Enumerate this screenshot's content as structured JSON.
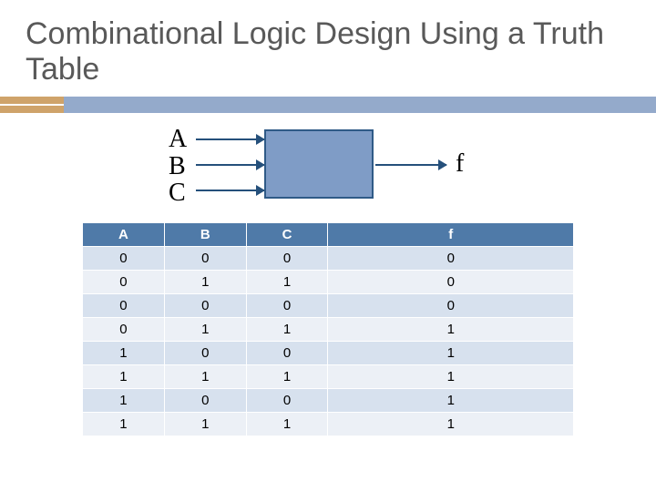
{
  "title": "Combinational Logic Design Using a Truth Table",
  "diagram": {
    "inputs": [
      "A",
      "B",
      "C"
    ],
    "output": "f"
  },
  "table": {
    "headers": {
      "a": "A",
      "b": "B",
      "c": "C",
      "f": "f"
    },
    "rows": [
      {
        "a": "0",
        "b": "0",
        "c": "0",
        "f": "0"
      },
      {
        "a": "0",
        "b": "1",
        "c": "1",
        "f": "0"
      },
      {
        "a": "0",
        "b": "0",
        "c": "0",
        "f": "0"
      },
      {
        "a": "0",
        "b": "1",
        "c": "1",
        "f": "1"
      },
      {
        "a": "1",
        "b": "0",
        "c": "0",
        "f": "1"
      },
      {
        "a": "1",
        "b": "1",
        "c": "1",
        "f": "1"
      },
      {
        "a": "1",
        "b": "0",
        "c": "0",
        "f": "1"
      },
      {
        "a": "1",
        "b": "1",
        "c": "1",
        "f": "1"
      }
    ]
  },
  "chart_data": {
    "type": "table",
    "title": "Combinational Logic Design Using a Truth Table",
    "columns": [
      "A",
      "B",
      "C",
      "f"
    ],
    "rows": [
      [
        0,
        0,
        0,
        0
      ],
      [
        0,
        1,
        1,
        0
      ],
      [
        0,
        0,
        0,
        0
      ],
      [
        0,
        1,
        1,
        1
      ],
      [
        1,
        0,
        0,
        1
      ],
      [
        1,
        1,
        1,
        1
      ],
      [
        1,
        0,
        0,
        1
      ],
      [
        1,
        1,
        1,
        1
      ]
    ]
  }
}
